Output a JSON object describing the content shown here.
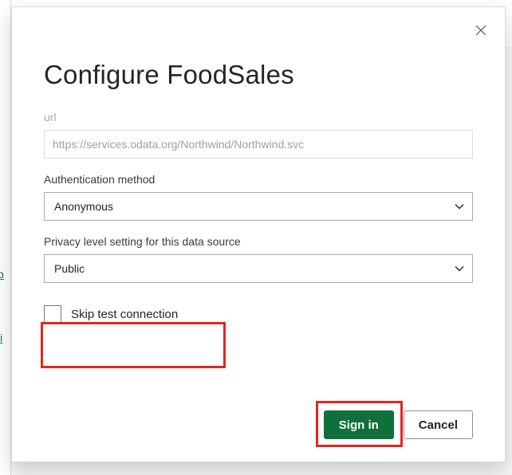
{
  "dialog": {
    "title": "Configure FoodSales",
    "url": {
      "label": "url",
      "value": "https://services.odata.org/Northwind/Northwind.svc"
    },
    "auth": {
      "label": "Authentication method",
      "value": "Anonymous"
    },
    "privacy": {
      "label": "Privacy level setting for this data source",
      "value": "Public"
    },
    "skip_test": {
      "label": "Skip test connection",
      "checked": false
    },
    "buttons": {
      "signin": "Sign in",
      "cancel": "Cancel"
    }
  },
  "background": {
    "link_fragment_1": "p",
    "link_fragment_2": "li"
  }
}
